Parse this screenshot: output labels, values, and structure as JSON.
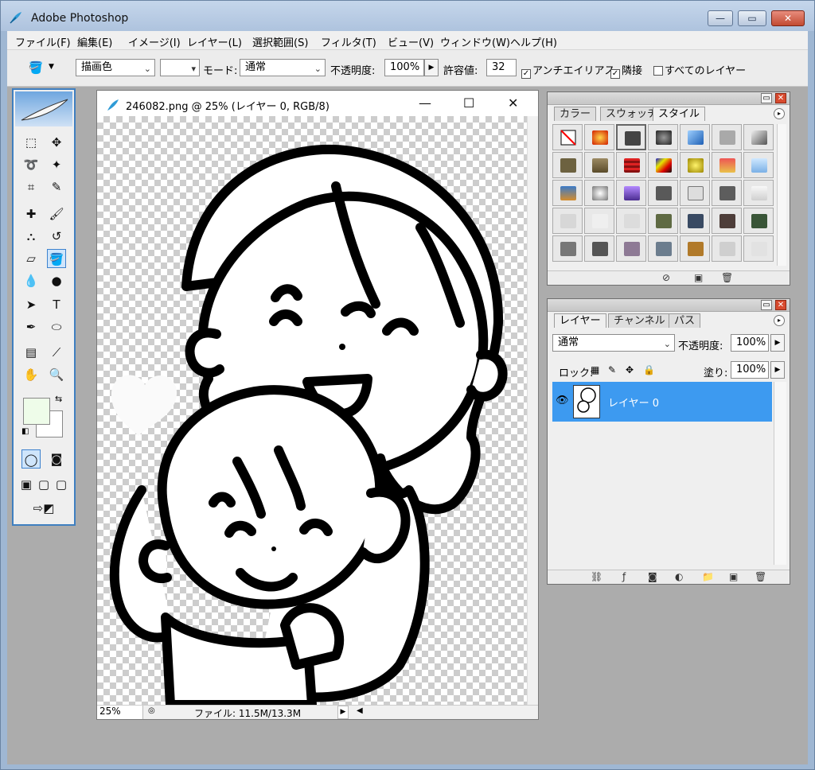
{
  "app": {
    "title": "Adobe Photoshop",
    "window_buttons": [
      "minimize",
      "maximize",
      "close"
    ]
  },
  "menubar": {
    "items": [
      "ファイル(F)",
      "編集(E)",
      "イメージ(I)",
      "レイヤー(L)",
      "選択範囲(S)",
      "フィルタ(T)",
      "ビュー(V)",
      "ウィンドウ(W)",
      "ヘルプ(H)"
    ]
  },
  "options": {
    "fill_source": "描画色",
    "mode_label": "モード:",
    "mode_value": "通常",
    "opacity_label": "不透明度:",
    "opacity_value": "100%",
    "tolerance_label": "許容値:",
    "tolerance_value": "32",
    "antialias_label": "アンチエイリアス",
    "contiguous_label": "隣接",
    "all_layers_label": "すべてのレイヤー"
  },
  "toolbox": {
    "foreground_color": "#eefce9",
    "background_color": "#ffffff"
  },
  "document": {
    "title": "246082.png @ 25% (レイヤー 0, RGB/8)",
    "zoom": "25%",
    "file_info": "ファイル: 11.5M/13.3M"
  },
  "styles_panel": {
    "tabs": [
      "カラー",
      "スウォッチ",
      "スタイル"
    ],
    "active_tab": "スタイル"
  },
  "layers_panel": {
    "tabs": [
      "レイヤー",
      "チャンネル",
      "パス"
    ],
    "active_tab": "レイヤー",
    "blend_mode": "通常",
    "opacity_label": "不透明度:",
    "opacity_value": "100%",
    "lock_label": "ロック:",
    "fill_label": "塗り:",
    "fill_value": "100%",
    "layers": [
      {
        "name": "レイヤー 0"
      }
    ]
  }
}
